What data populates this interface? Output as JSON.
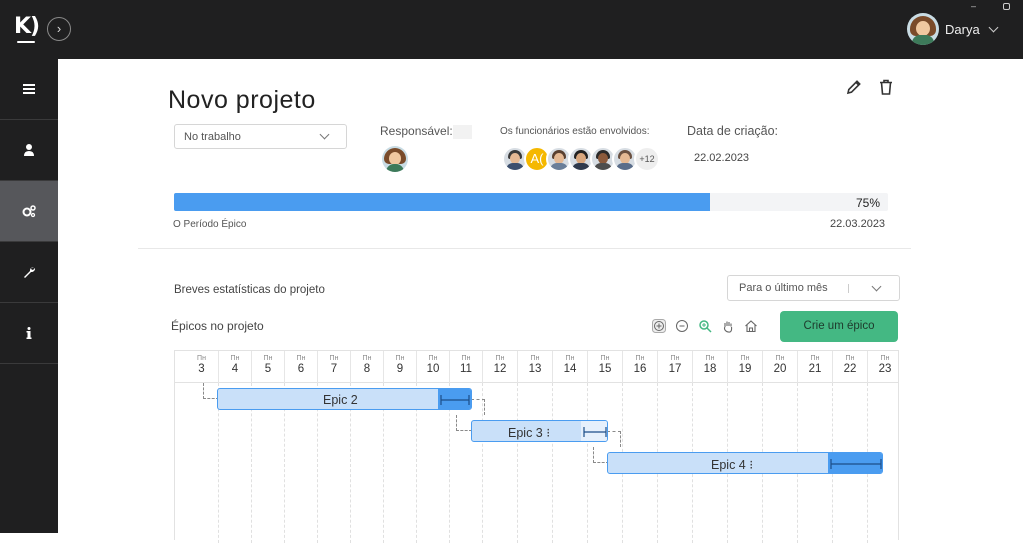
{
  "header": {
    "logo_text": "K)",
    "user_name": "Darya"
  },
  "sidebar": {
    "items": [
      {
        "icon": "list-icon"
      },
      {
        "icon": "user-icon"
      },
      {
        "icon": "gears-icon",
        "active": true
      },
      {
        "icon": "wrench-icon"
      },
      {
        "icon": "info-icon"
      }
    ]
  },
  "project": {
    "title": "Novo projeto",
    "status": "No trabalho",
    "responsible_label": "Responsável:",
    "employees_label": "Os funcionários estão envolvidos:",
    "employees_letter": "A(",
    "employees_more": "+12",
    "creation_label": "Data de criação:",
    "creation_date": "22.02.2023",
    "progress_percent": 75,
    "progress_text": "75%",
    "period_label": "O Período Épico",
    "end_date": "22.03.2023"
  },
  "stats": {
    "label": "Breves estatísticas do projeto",
    "period_select": "Para o último mês"
  },
  "epics": {
    "label": "Épicos no projeto",
    "create_button": "Crie um épico",
    "weekday": "Пн",
    "days": [
      "3",
      "4",
      "5",
      "6",
      "7",
      "8",
      "9",
      "10",
      "11",
      "12",
      "13",
      "14",
      "15",
      "16",
      "17",
      "18",
      "19",
      "20",
      "21",
      "22",
      "23"
    ],
    "bars": [
      {
        "name": "Epic 2"
      },
      {
        "name": "Epic 3 ⁝"
      },
      {
        "name": "Epic 4 ⁝"
      }
    ]
  },
  "colors": {
    "accent": "#4a9cf0",
    "create_button": "#44b883",
    "sidebar": "#1f1f20"
  }
}
